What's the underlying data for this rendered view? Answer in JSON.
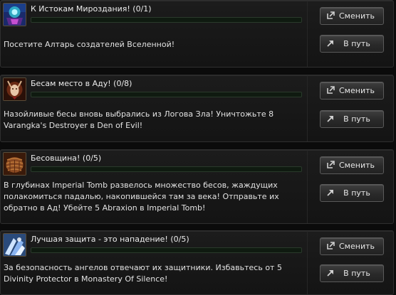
{
  "quests": [
    {
      "title": "К Истокам Мироздания! (0/1)",
      "progress": 0,
      "description": "Посетите Алтарь создателей Вселенной!",
      "icon": "altar-icon",
      "change_label": "Сменить",
      "go_label": "В путь"
    },
    {
      "title": "Бесам место в Аду! (0/8)",
      "progress": 0,
      "description": "Назойливые бесы вновь выбрались из Логова Зла! Уничтожьте 8 Varangka's Destroyer в Den of Evil!",
      "icon": "demon-icon",
      "change_label": "Сменить",
      "go_label": "В путь"
    },
    {
      "title": "Бесовщина! (0/5)",
      "progress": 0,
      "description": "В глубинах Imperial Tomb развелось множество бесов, жаждущих полакомиться падалью, накопившейся там за века! Отправьте их обратно в Ад! Убейте 5 Abraxion в Imperial Tomb!",
      "icon": "scales-icon",
      "change_label": "Сменить",
      "go_label": "В путь"
    },
    {
      "title": "Лучшая защита - это нападение! (0/5)",
      "progress": 0,
      "description": "За безопасность ангелов отвечают их защитники. Избавьтесь от 5 Divinity Protector в Monastery Of Silence!",
      "icon": "angel-icon",
      "change_label": "Сменить",
      "go_label": "В путь"
    }
  ]
}
